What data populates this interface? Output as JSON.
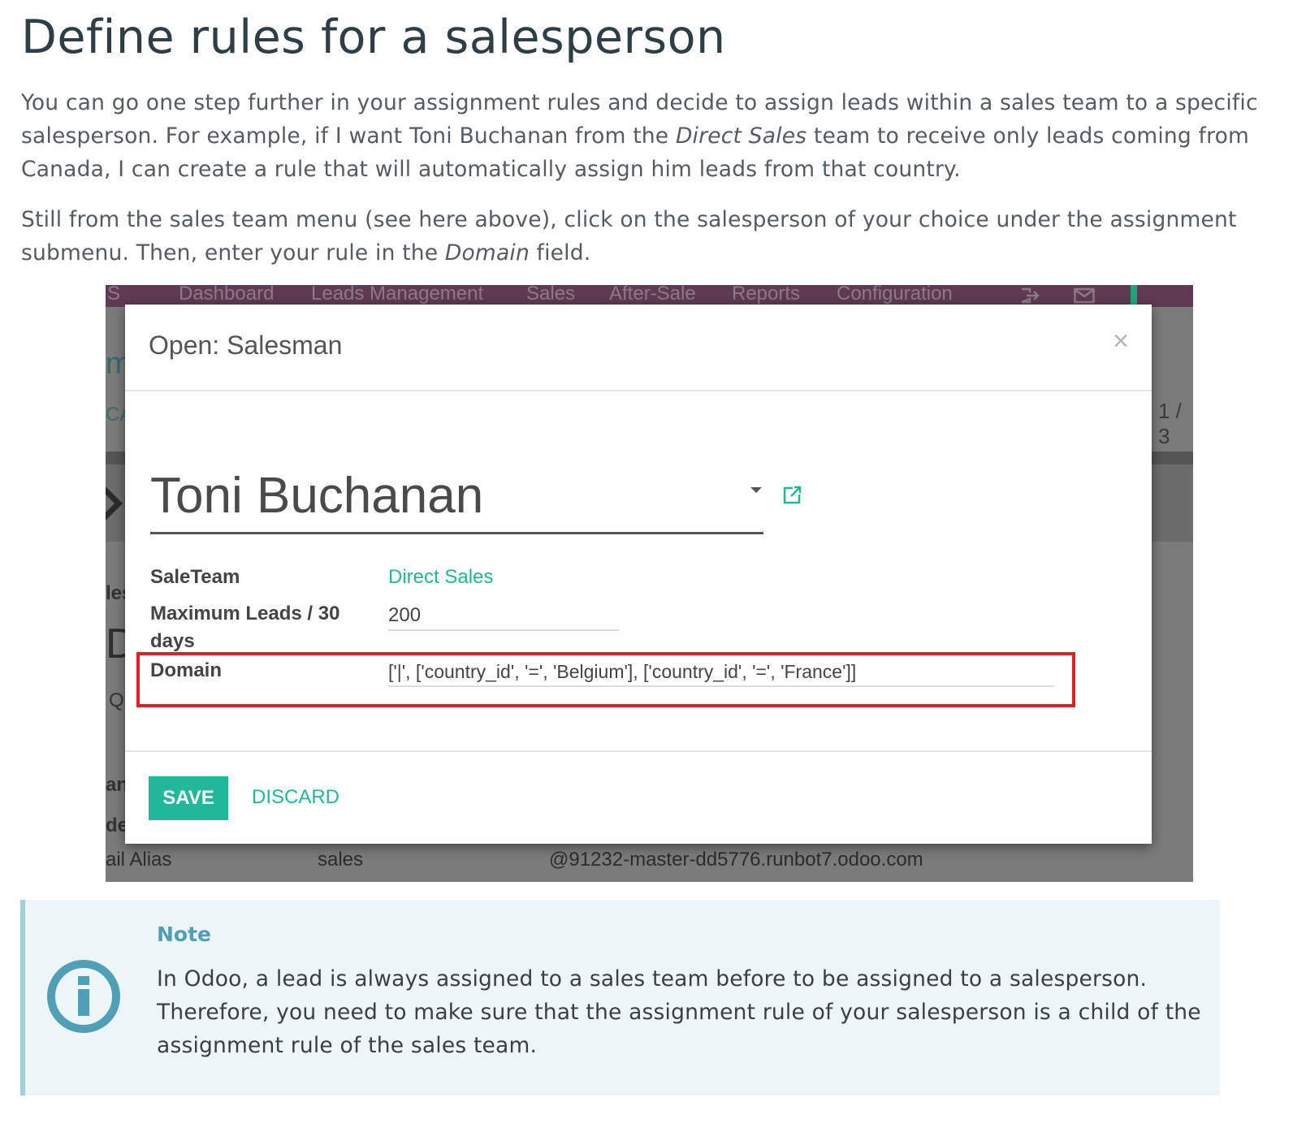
{
  "heading": "Define rules for a salesperson",
  "paragraph1": {
    "part1": "You can go one step further in your assignment rules and decide to assign leads within a sales team to a specific salesperson. For example, if I want Toni Buchanan from the ",
    "em": "Direct Sales",
    "part2": " team to receive only leads coming from Canada, I can create a rule that will automatically assign him leads from that country."
  },
  "paragraph2": {
    "part1": "Still from the sales team menu (see here above), click on the salesperson of your choice under the assignment submenu. Then, enter your rule in the ",
    "em": "Domain",
    "part2": " field."
  },
  "screenshot": {
    "topbar": {
      "logo_fragment": "S",
      "menu": [
        "Dashboard",
        "Leads Management",
        "Sales",
        "After-Sale",
        "Reports",
        "Configuration"
      ]
    },
    "background_fragments": {
      "title_fragment": "m",
      "breadcrumb_fragment": "CA",
      "pager_fragment": "1 / 3",
      "side_1": "les",
      "side_2": "Di",
      "side_3": "Q",
      "side_4": "an",
      "side_5": "de",
      "alias_label": "ail Alias",
      "alias_name": "sales",
      "alias_domain": "@91232-master-dd5776.runbot7.odoo.com"
    },
    "modal": {
      "title": "Open: Salesman",
      "close": "×",
      "salesman_name": "Toni Buchanan",
      "fields": {
        "saleteam_label": "SaleTeam",
        "saleteam_value": "Direct Sales",
        "max_leads_label": "Maximum Leads / 30 days",
        "max_leads_value": "200",
        "domain_label": "Domain",
        "domain_value": "['|', ['country_id', '=', 'Belgium'], ['country_id', '=', 'France']]"
      },
      "save_label": "SAVE",
      "discard_label": "DISCARD"
    }
  },
  "note": {
    "title": "Note",
    "text": "In Odoo, a lead is always assigned to a sales team before to be assigned to a salesperson. Therefore, you need to make sure that the assignment rule of your salesperson is a child of the assignment rule of the sales team."
  },
  "colors": {
    "accent_green": "#21b799",
    "highlight_red": "#e41e26",
    "note_blue": "#4f9fb6",
    "topbar_purple": "#5f3a52"
  }
}
